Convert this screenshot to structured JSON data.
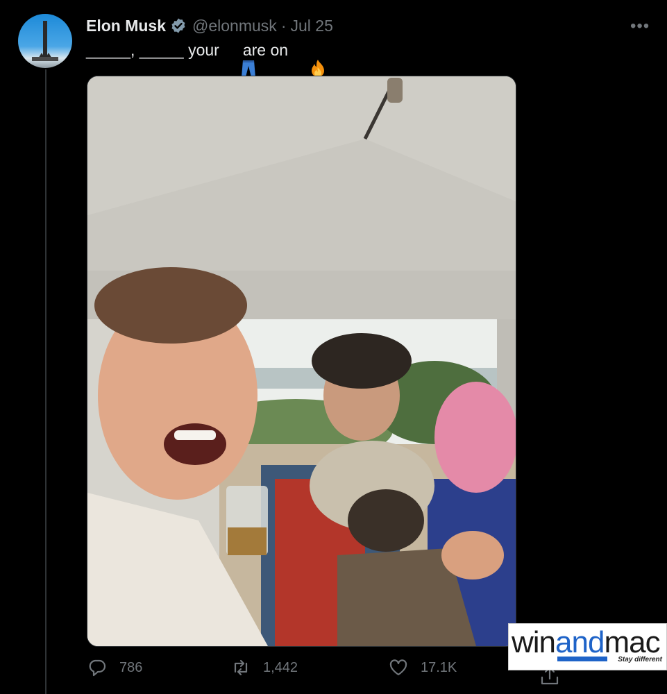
{
  "tweet": {
    "author_name": "Elon Musk",
    "handle": "@elonmusk",
    "separator": "·",
    "date": "Jul 25",
    "text_part1": "_____, _____ your",
    "text_part2": "are on",
    "emoji_1": "jeans-icon",
    "emoji_2": "fire-icon"
  },
  "more_menu": "•••",
  "actions": {
    "replies": "786",
    "retweets": "1,442",
    "likes": "17.1K"
  },
  "watermark": {
    "brand_win": "win",
    "brand_and": "and",
    "brand_mac": "mac",
    "tagline": "Stay different"
  },
  "colors": {
    "background": "#000000",
    "secondary_text": "#71767b",
    "verified": "#829aab",
    "brand_blue": "#1e63c8"
  }
}
